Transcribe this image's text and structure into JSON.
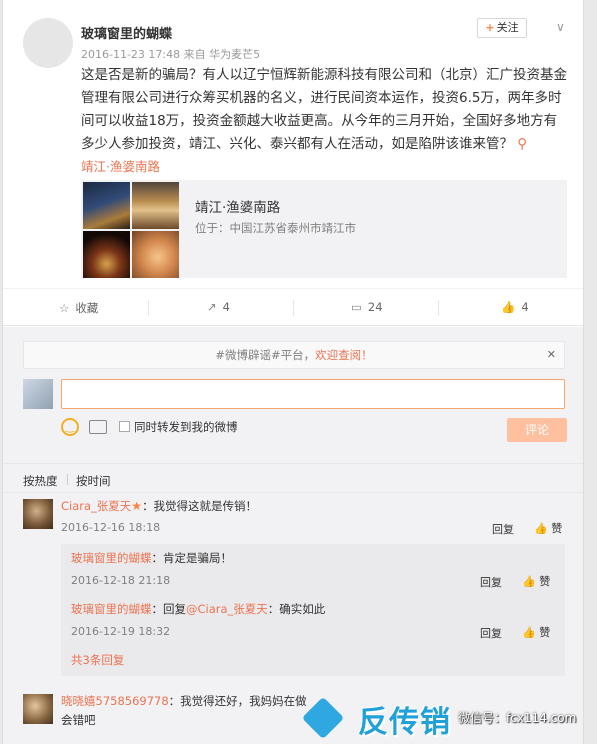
{
  "post": {
    "author": "玻璃窗里的蝴蝶",
    "meta": "2016-11-23 17:48 来自 华为麦芒5",
    "follow_label": "关注",
    "text": "这是否是新的骗局？有人以辽宁恒辉新能源科技有限公司和（北京）汇广投资基金管理有限公司进行众筹买机器的名义，进行民间资本运作，投资6.5万，两年多时间可以收益18万，投资金额越大收益更高。从今年的三月开始，全国好多地方有多少人参加投资，靖江、兴化、泰兴都有人在活动，如是陷阱该谁来管？",
    "location": "靖江·渔婆南路",
    "location_card": {
      "name": "靖江·渔婆南路",
      "address": "位于：中国江苏省泰州市靖江市"
    }
  },
  "actions": {
    "favorite": "收藏",
    "forward": "4",
    "comment": "24",
    "like": "4"
  },
  "comment_box": {
    "notice_prefix": "#微博辟谣#平台，",
    "notice_link": "欢迎查阅！",
    "forward_checkbox_label": "同时转发到我的微博",
    "submit_label": "评论"
  },
  "sort": {
    "by_heat": "按热度",
    "by_time": "按时间"
  },
  "comments": [
    {
      "name": "Ciara_张夏天",
      "text": "：我觉得这就是传销！",
      "time": "2016-12-16 18:18",
      "reply_label": "回复",
      "like_label": "赞",
      "replies": [
        {
          "name": "玻璃窗里的蝴蝶",
          "text": "：肯定是骗局！",
          "time": "2016-12-18 21:18",
          "reply_label": "回复",
          "like_label": "赞"
        },
        {
          "name": "玻璃窗里的蝴蝶",
          "prefix": "：回复",
          "mention": "@Ciara_张夏天",
          "text": "：确实如此",
          "time": "2016-12-19 18:32",
          "reply_label": "回复",
          "like_label": "赞"
        }
      ],
      "more_replies": "共3条回复"
    },
    {
      "name": "晓晓嬉5758569778",
      "text": "：我觉得还好，我妈妈在做",
      "text_cont": "会错吧"
    }
  ],
  "watermark": {
    "brand": "反传销",
    "sub": "微信号：fcx114.com"
  },
  "colors": {
    "accent": "#eb7350",
    "page_bg": "#e9e9e9",
    "comment_bg": "#f2f2f5"
  }
}
